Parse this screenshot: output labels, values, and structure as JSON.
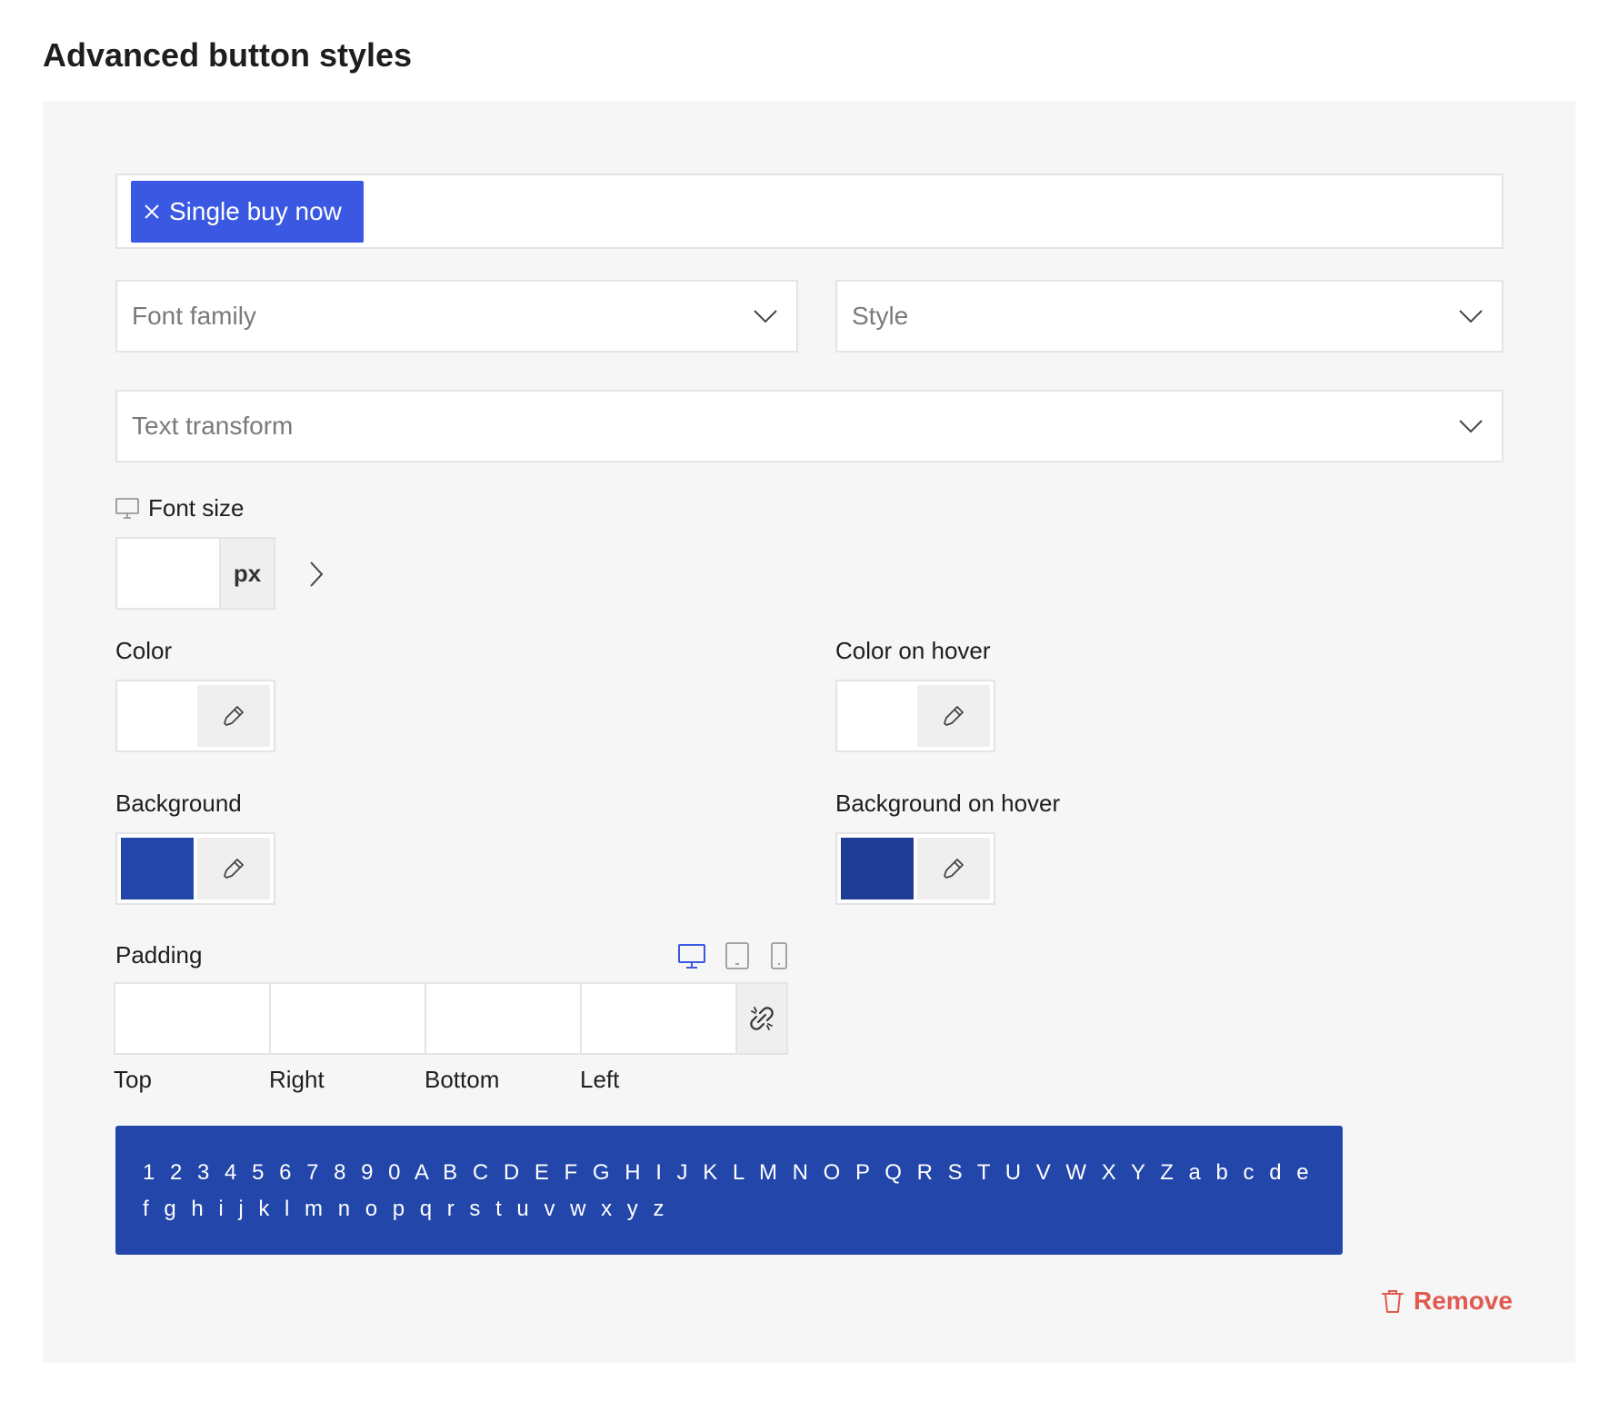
{
  "page": {
    "title": "Advanced button styles"
  },
  "tag_field": {
    "chips": [
      {
        "label": "Single buy now"
      }
    ]
  },
  "font_family": {
    "placeholder": "Font family"
  },
  "style": {
    "placeholder": "Style"
  },
  "text_transform": {
    "placeholder": "Text transform"
  },
  "font_size": {
    "label": "Font size",
    "value": "",
    "unit": "px"
  },
  "color": {
    "label": "Color",
    "swatch": "#ffffff"
  },
  "color_hover": {
    "label": "Color on hover",
    "swatch": "#ffffff"
  },
  "background": {
    "label": "Background",
    "swatch": "#2246a9"
  },
  "background_hover": {
    "label": "Background on hover",
    "swatch": "#1f3d94"
  },
  "padding": {
    "label": "Padding",
    "fields": [
      "Top",
      "Right",
      "Bottom",
      "Left"
    ],
    "devices": [
      "desktop-icon",
      "tablet-icon",
      "mobile-icon"
    ],
    "active_device": "desktop"
  },
  "preview": {
    "text": "1 2 3 4 5 6 7 8 9 0 A B C D E F G H I J K L M N O P Q R S T U V W X Y Z a b c d e f g h i j k l m n o p q r s t u v w x y z"
  },
  "actions": {
    "remove_label": "Remove"
  },
  "colors": {
    "accent": "#3a58e2",
    "preview_bg": "#2246a9",
    "danger": "#e05a50",
    "panel_bg": "#f6f6f6"
  }
}
